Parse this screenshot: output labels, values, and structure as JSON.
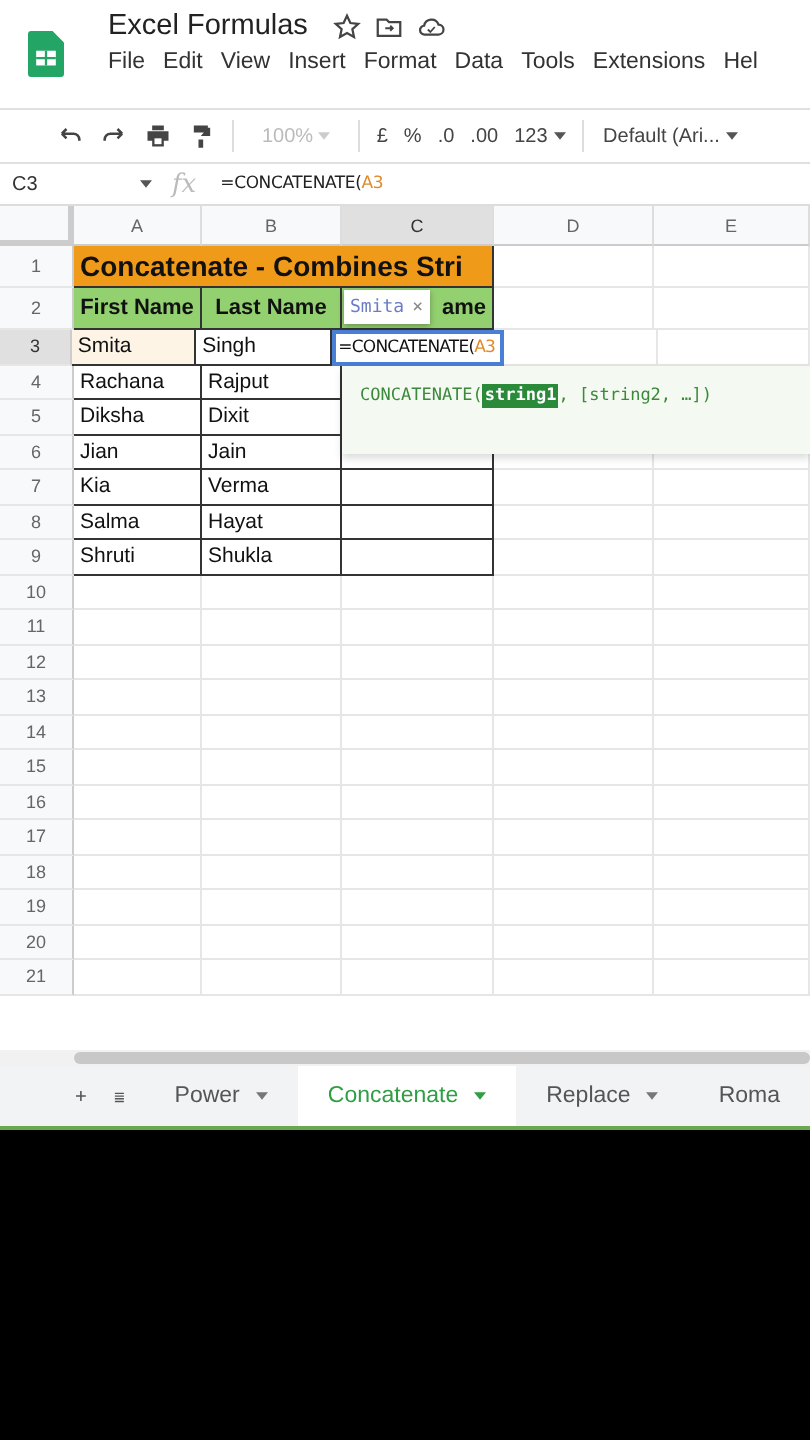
{
  "app": {
    "title": "Excel Formulas",
    "menu": [
      "File",
      "Edit",
      "View",
      "Insert",
      "Format",
      "Data",
      "Tools",
      "Extensions",
      "Hel"
    ]
  },
  "toolbar": {
    "zoom": "100%",
    "currency": "£",
    "percent": "%",
    "decrease_decimal": ".0",
    "increase_decimal": ".00",
    "number_format": "123",
    "font": "Default (Ari..."
  },
  "formula_bar": {
    "cell_ref": "C3",
    "fx_label": "fx",
    "formula": "=CONCATENATE(",
    "formula_ref": "A3"
  },
  "sheet": {
    "columns": [
      {
        "label": "A",
        "selected": false
      },
      {
        "label": "B",
        "selected": false
      },
      {
        "label": "C",
        "selected": true
      },
      {
        "label": "D",
        "selected": false
      },
      {
        "label": "E",
        "selected": false
      }
    ],
    "row_numbers": [
      {
        "label": "1",
        "selected": false
      },
      {
        "label": "2",
        "selected": false
      },
      {
        "label": "3",
        "selected": true
      },
      {
        "label": "4",
        "selected": false
      },
      {
        "label": "5",
        "selected": false
      },
      {
        "label": "6",
        "selected": false
      },
      {
        "label": "7",
        "selected": false
      },
      {
        "label": "8",
        "selected": false
      },
      {
        "label": "9",
        "selected": false
      },
      {
        "label": "10",
        "selected": false
      },
      {
        "label": "11",
        "selected": false
      },
      {
        "label": "12",
        "selected": false
      },
      {
        "label": "13",
        "selected": false
      },
      {
        "label": "14",
        "selected": false
      },
      {
        "label": "15",
        "selected": false
      },
      {
        "label": "16",
        "selected": false
      },
      {
        "label": "17",
        "selected": false
      },
      {
        "label": "18",
        "selected": false
      },
      {
        "label": "19",
        "selected": false
      },
      {
        "label": "20",
        "selected": false
      },
      {
        "label": "21",
        "selected": false
      }
    ],
    "title_cell": "Concatenate - Combines Stri",
    "header_cells": [
      "First Name",
      "Last Name",
      "ame"
    ],
    "data_rows": [
      [
        "Smita",
        "Singh"
      ],
      [
        "Rachana",
        "Rajput"
      ],
      [
        "Diksha",
        "Dixit"
      ],
      [
        "Jian",
        "Jain"
      ],
      [
        "Kia",
        "Verma"
      ],
      [
        "Salma",
        "Hayat"
      ],
      [
        "Shruti",
        "Shukla"
      ]
    ],
    "edit_cell": {
      "formula": "=CONCATENATE(",
      "ref": "A3"
    },
    "ref_tooltip": {
      "text": "Smita",
      "close": "×"
    },
    "autocomplete": {
      "function": "CONCATENATE(",
      "active_arg": "string1",
      "rest": ", [string2, …])"
    }
  },
  "tabs": [
    {
      "label": "Power",
      "selected": false
    },
    {
      "label": "Concatenate",
      "selected": true
    },
    {
      "label": "Replace",
      "selected": false
    },
    {
      "label": "Roma",
      "selected": false
    }
  ]
}
